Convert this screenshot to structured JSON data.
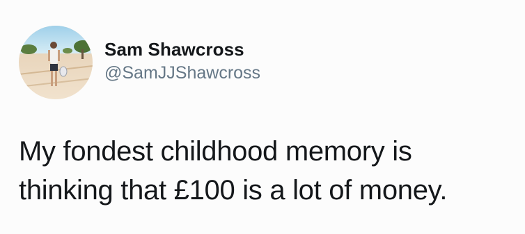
{
  "author": {
    "display_name": "Sam Shawcross",
    "handle": "@SamJJShawcross",
    "avatar_icon": "profile-photo"
  },
  "tweet": {
    "lines": [
      "My fondest childhood memory is",
      "thinking that £100 is a lot of money."
    ]
  },
  "colors": {
    "background": "#fcfcfc",
    "text": "#14171a",
    "handle": "#657786"
  }
}
